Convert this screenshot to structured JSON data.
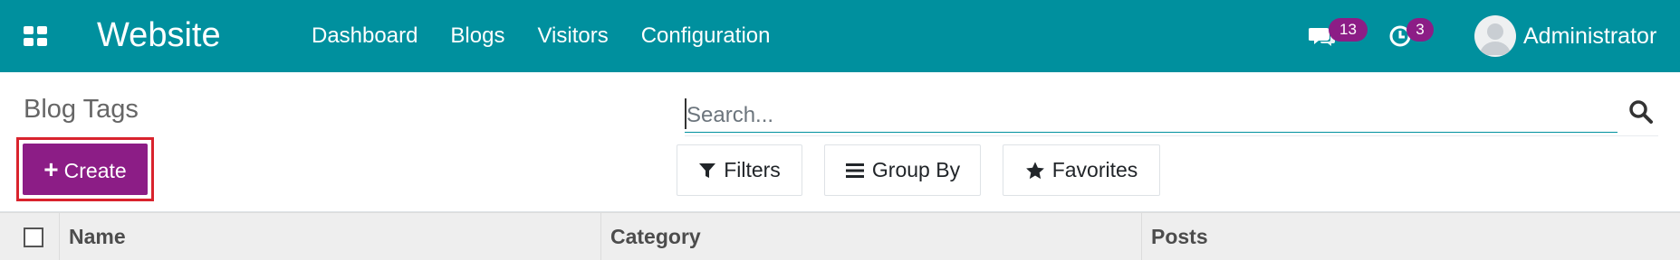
{
  "navbar": {
    "app_name": "Website",
    "menu": [
      "Dashboard",
      "Blogs",
      "Visitors",
      "Configuration"
    ],
    "messages_count": "13",
    "activities_count": "3",
    "user_name": "Administrator",
    "background_color": "#00909e"
  },
  "control_panel": {
    "breadcrumb": "Blog Tags",
    "create_label": "Create",
    "search": {
      "placeholder": "Search...",
      "value": ""
    },
    "filters_label": "Filters",
    "groupby_label": "Group By",
    "favorites_label": "Favorites"
  },
  "table": {
    "columns": [
      "Name",
      "Category",
      "Posts"
    ]
  },
  "colors": {
    "accent": "#8c1d86",
    "highlight_outline": "#d9232d"
  }
}
